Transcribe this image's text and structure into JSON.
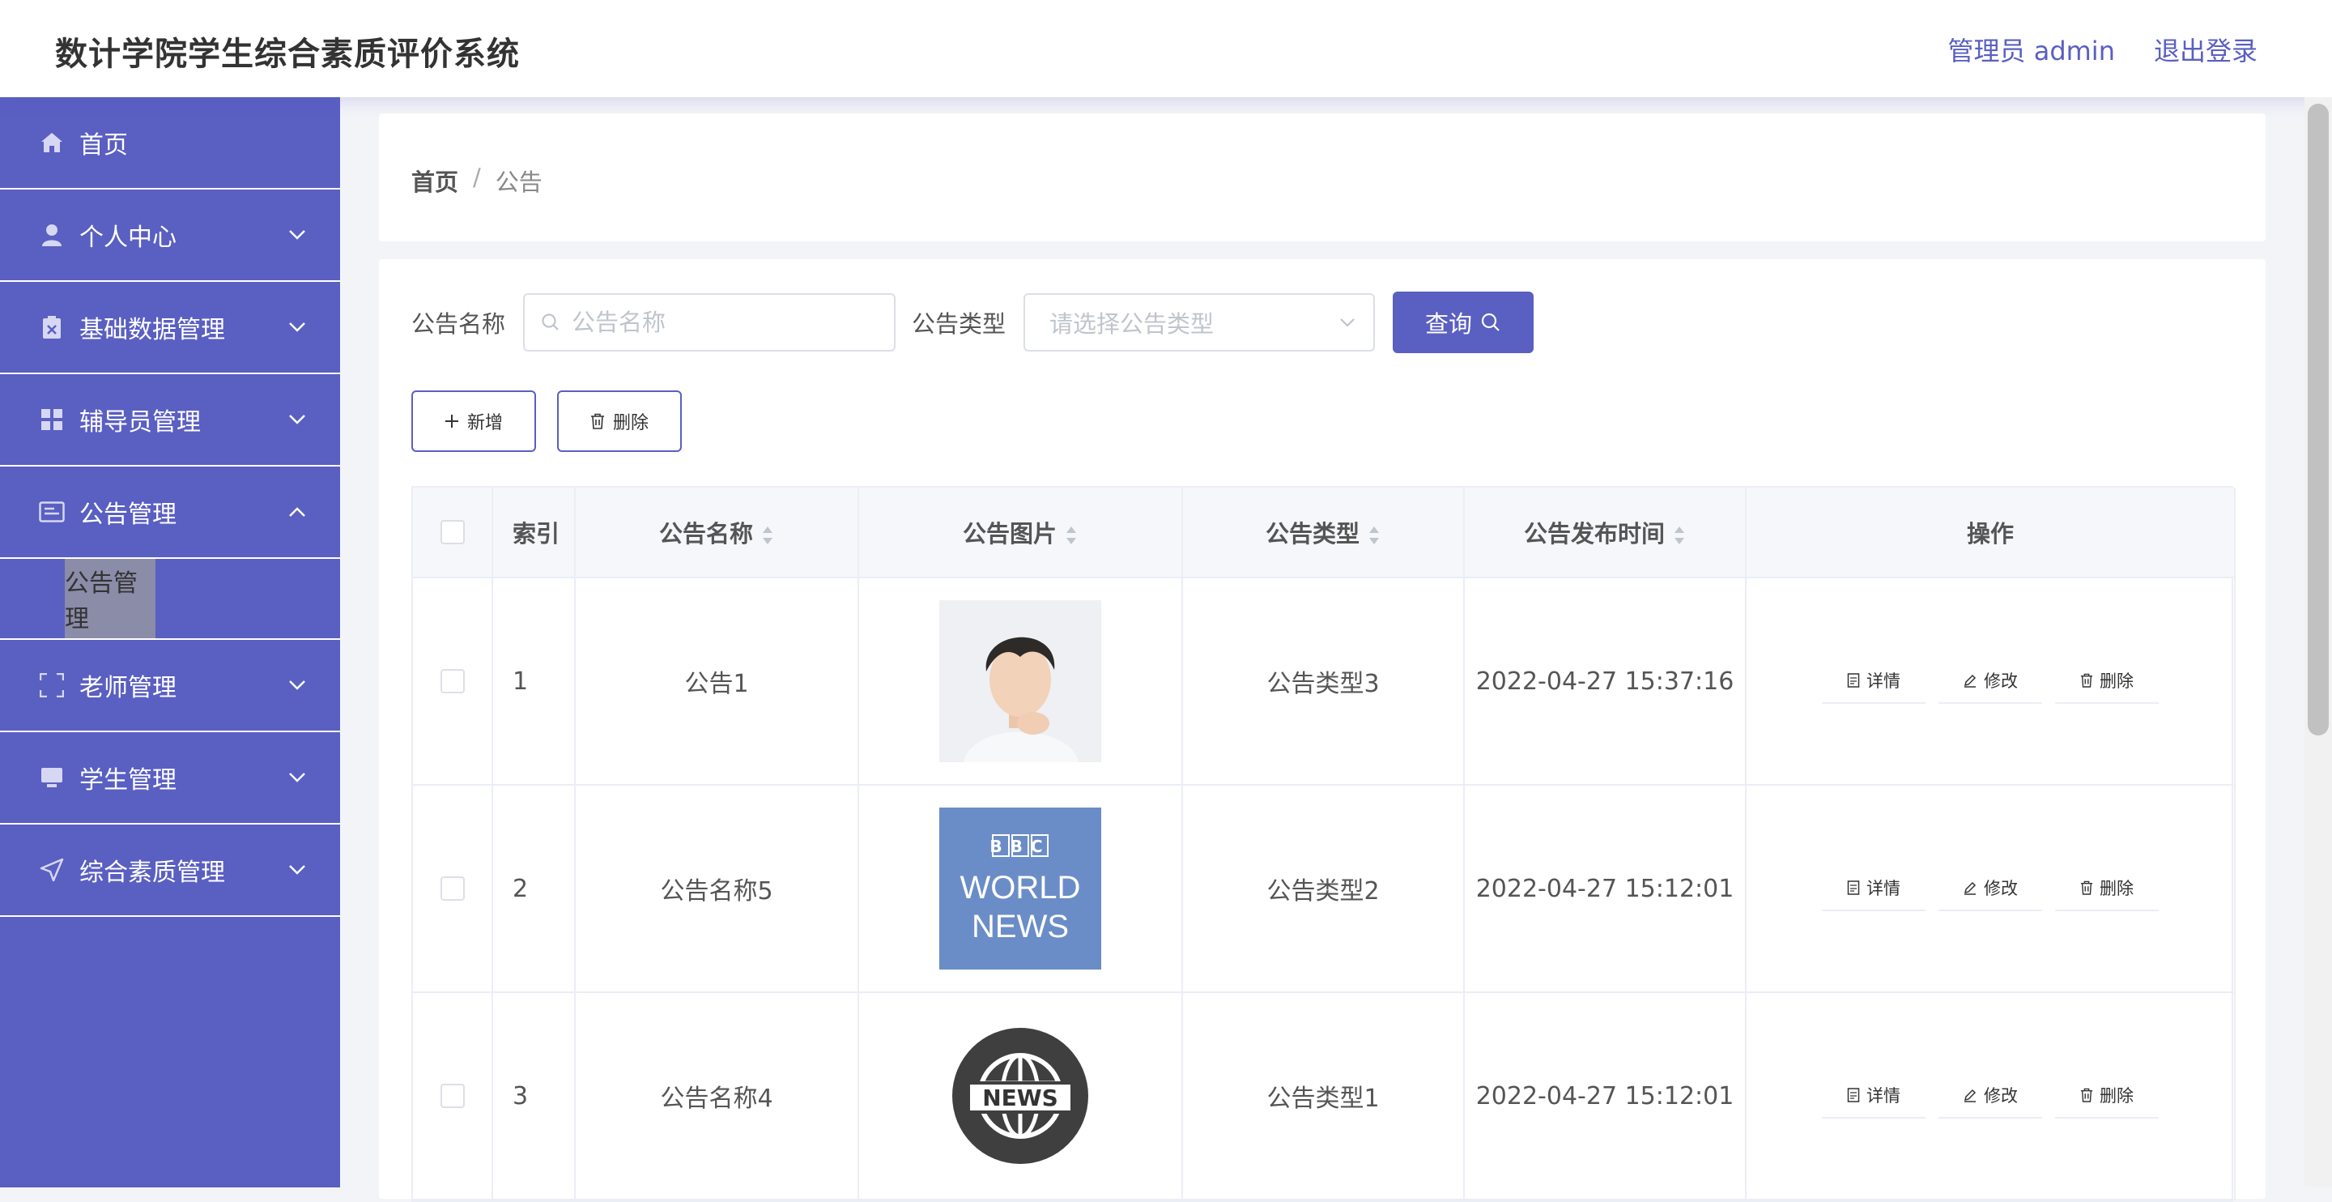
{
  "header": {
    "title": "数计学院学生综合素质评价系统",
    "user_label": "管理员 admin",
    "logout_label": "退出登录"
  },
  "sidebar": {
    "items": [
      {
        "label": "首页",
        "icon": "home-icon"
      },
      {
        "label": "个人中心",
        "icon": "user-icon"
      },
      {
        "label": "基础数据管理",
        "icon": "clipboard-icon"
      },
      {
        "label": "辅导员管理",
        "icon": "grid-icon"
      },
      {
        "label": "公告管理",
        "icon": "notice-icon"
      },
      {
        "label": "老师管理",
        "icon": "frame-icon"
      },
      {
        "label": "学生管理",
        "icon": "monitor-icon"
      },
      {
        "label": "综合素质管理",
        "icon": "send-icon"
      }
    ],
    "submenu_label": "公告管理"
  },
  "breadcrumb": {
    "home": "首页",
    "separator": "/",
    "current": "公告"
  },
  "search": {
    "name_label": "公告名称",
    "name_placeholder": "公告名称",
    "type_label": "公告类型",
    "type_placeholder": "请选择公告类型",
    "query_label": "查询"
  },
  "actions": {
    "add_label": "新增",
    "delete_label": "删除"
  },
  "table": {
    "headers": {
      "index": "索引",
      "name": "公告名称",
      "image": "公告图片",
      "type": "公告类型",
      "time": "公告发布时间",
      "ops": "操作"
    },
    "op_labels": {
      "detail": "详情",
      "edit": "修改",
      "delete": "删除"
    },
    "rows": [
      {
        "index": "1",
        "name": "公告1",
        "type": "公告类型3",
        "time": "2022-04-27 15:37:16"
      },
      {
        "index": "2",
        "name": "公告名称5",
        "type": "公告类型2",
        "time": "2022-04-27 15:12:01"
      },
      {
        "index": "3",
        "name": "公告名称4",
        "type": "公告类型1",
        "time": "2022-04-27 15:12:01"
      }
    ],
    "images": {
      "bbc_top": "BBC",
      "bbc_l1": "WORLD",
      "bbc_l2": "NEWS",
      "news": "NEWS"
    }
  },
  "colors": {
    "accent": "#5a5fc2",
    "submenu_bg": "#8a8ca8"
  }
}
